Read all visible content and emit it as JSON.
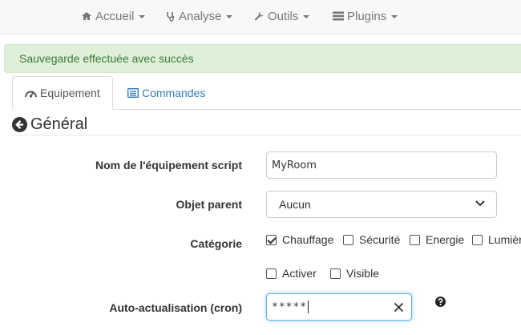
{
  "nav": {
    "items": [
      {
        "label": "Accueil"
      },
      {
        "label": "Analyse"
      },
      {
        "label": "Outils"
      },
      {
        "label": "Plugins"
      }
    ]
  },
  "alert": {
    "message": "Sauvegarde effectuée avec succès"
  },
  "tabs": [
    {
      "label": "Equipement",
      "active": true
    },
    {
      "label": "Commandes",
      "active": false
    }
  ],
  "section": {
    "title": "Général"
  },
  "form": {
    "name_label": "Nom de l'équipement script",
    "name_value": "MyRoom",
    "parent_label": "Objet parent",
    "parent_value": "Aucun",
    "category_label": "Catégorie",
    "categories": [
      {
        "label": "Chauffage",
        "checked": true
      },
      {
        "label": "Sécurité",
        "checked": false
      },
      {
        "label": "Energie",
        "checked": false
      },
      {
        "label": "Lumière",
        "checked": false
      }
    ],
    "options": [
      {
        "label": "Activer",
        "checked": false
      },
      {
        "label": "Visible",
        "checked": false
      }
    ],
    "cron_label": "Auto-actualisation (cron)",
    "cron_value": "*****"
  },
  "colors": {
    "link": "#337ab7",
    "success_bg": "#dff0d8",
    "success_text": "#3c763d"
  }
}
